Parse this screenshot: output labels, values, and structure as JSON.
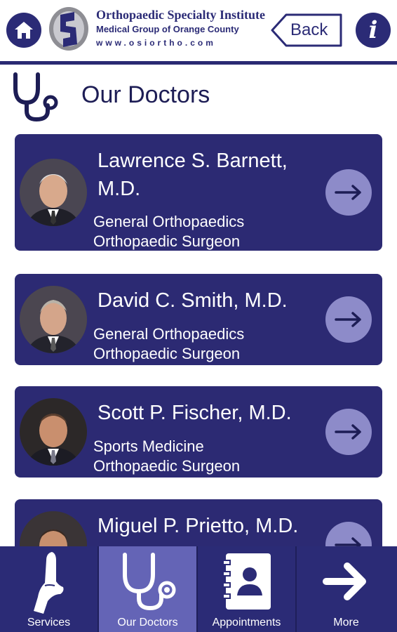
{
  "header": {
    "org_line1": "Orthopaedic Specialty Institute",
    "org_line2": "Medical Group of Orange County",
    "org_line3": "www.osiortho.com",
    "back_label": "Back",
    "info_label": "i",
    "home_icon": "home-icon",
    "logo_icon": "osi-logo"
  },
  "page": {
    "title": "Our Doctors",
    "title_icon": "stethoscope-icon"
  },
  "doctors": [
    {
      "name": "Lawrence S. Barnett, M.D.",
      "specialty": "General Orthopaedics",
      "role": "Orthopaedic Surgeon"
    },
    {
      "name": "David C. Smith, M.D.",
      "specialty": "General Orthopaedics",
      "role": "Orthopaedic Surgeon"
    },
    {
      "name": "Scott P. Fischer, M.D.",
      "specialty": "Sports Medicine",
      "role": "Orthopaedic Surgeon"
    },
    {
      "name": "Miguel P. Prietto, M.D.",
      "specialty": "",
      "role": ""
    }
  ],
  "bottom_nav": {
    "items": [
      {
        "label": "Services",
        "icon": "bone-icon"
      },
      {
        "label": "Our Doctors",
        "icon": "stethoscope-icon",
        "active": true
      },
      {
        "label": "Appointments",
        "icon": "address-book-icon"
      },
      {
        "label": "More",
        "icon": "arrow-right-icon"
      }
    ]
  },
  "colors": {
    "brand_navy": "#2b2b76",
    "card_bg": "#2c2a73",
    "arrow_circle": "#8d8bc9",
    "active_tab": "#6464b6"
  }
}
